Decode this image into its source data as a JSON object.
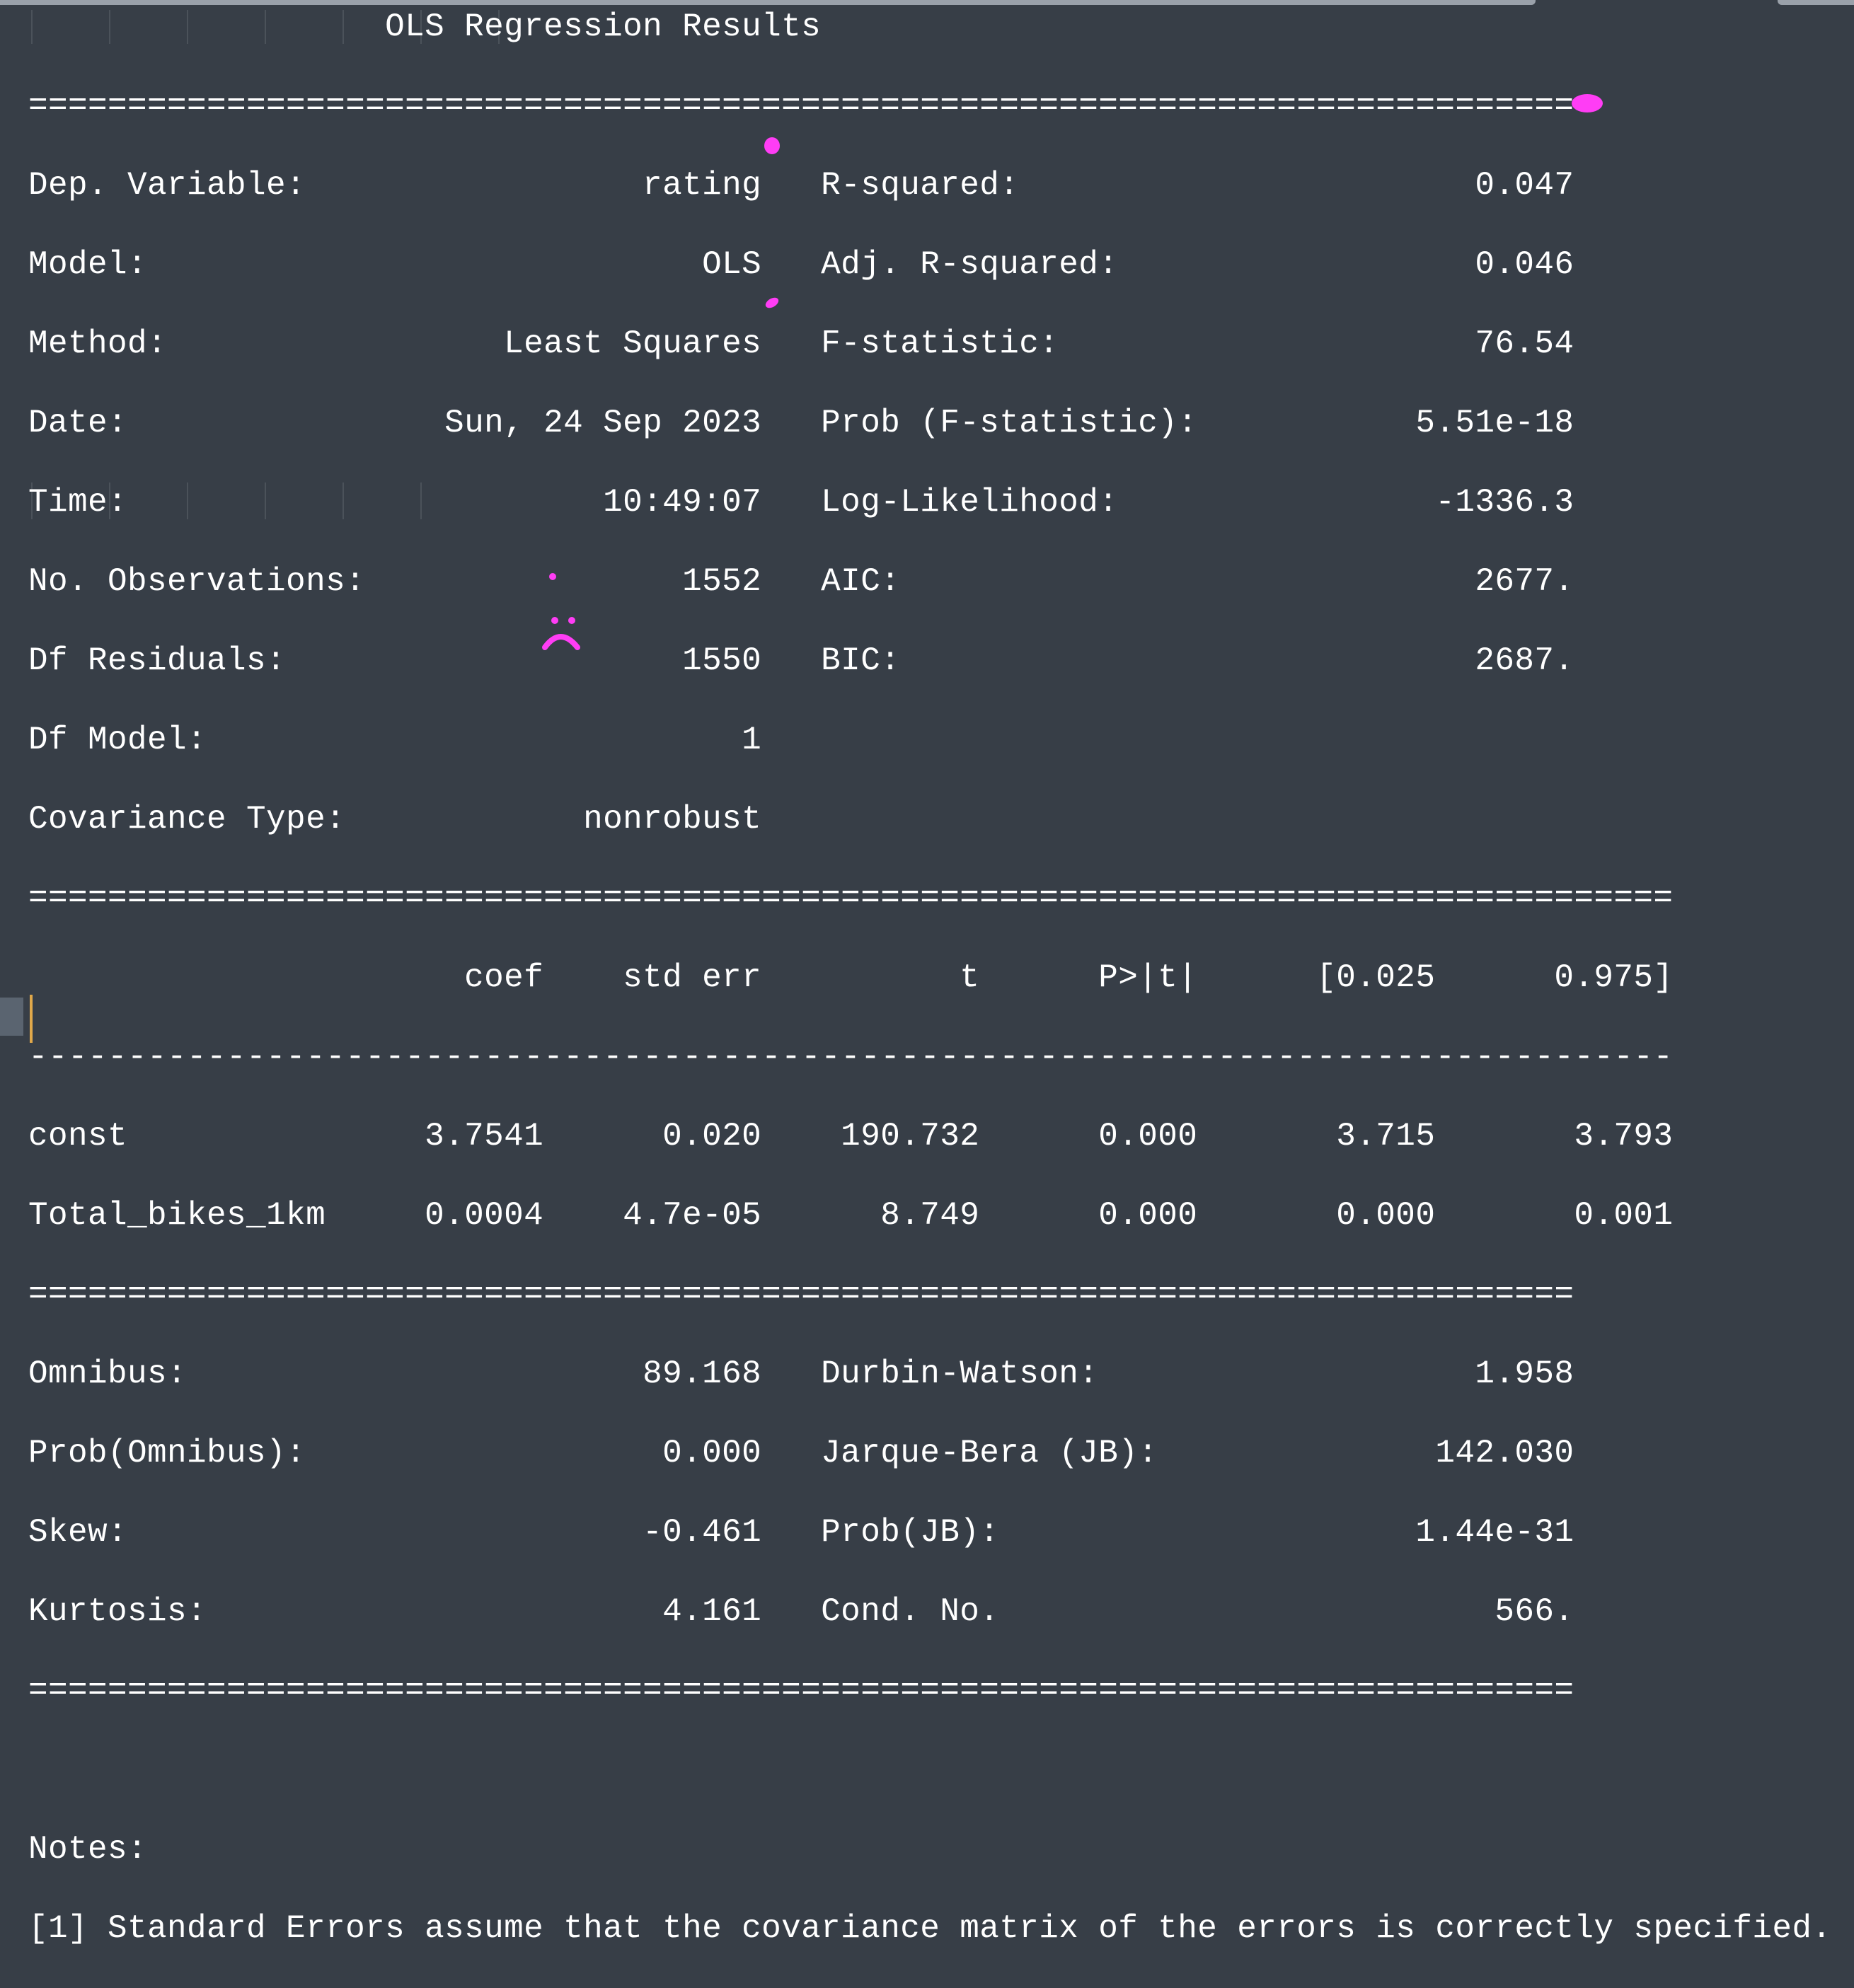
{
  "summary_lines": [
    "                  OLS Regression Results",
    "==============================================================================",
    "Dep. Variable:                 rating   R-squared:                       0.047",
    "Model:                            OLS   Adj. R-squared:                  0.046",
    "Method:                 Least Squares   F-statistic:                     76.54",
    "Date:                Sun, 24 Sep 2023   Prob (F-statistic):           5.51e-18",
    "Time:                        10:49:07   Log-Likelihood:                -1336.3",
    "No. Observations:                1552   AIC:                             2677.",
    "Df Residuals:                    1550   BIC:                             2687.",
    "Df Model:                           1",
    "Covariance Type:            nonrobust",
    "===================================================================================",
    "                      coef    std err          t      P>|t|      [0.025      0.975]",
    "-----------------------------------------------------------------------------------",
    "const               3.7541      0.020    190.732      0.000       3.715       3.793",
    "Total_bikes_1km     0.0004    4.7e-05      8.749      0.000       0.000       0.001",
    "==============================================================================",
    "Omnibus:                       89.168   Durbin-Watson:                   1.958",
    "Prob(Omnibus):                  0.000   Jarque-Bera (JB):              142.030",
    "Skew:                          -0.461   Prob(JB):                     1.44e-31",
    "Kurtosis:                       4.161   Cond. No.                         566.",
    "==============================================================================",
    "",
    "Notes:",
    "[1] Standard Errors assume that the covariance matrix of the errors is correctly specified."
  ],
  "colors": {
    "background": "#373e47",
    "text": "#ffffff",
    "annotation": "#ff3df5",
    "cursor": "#e0a84a"
  }
}
